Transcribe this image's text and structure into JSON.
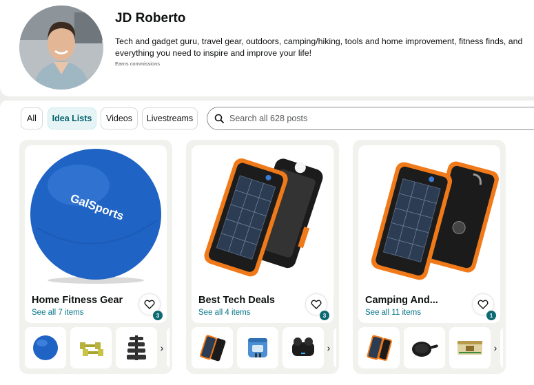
{
  "profile": {
    "name": "JD Roberto",
    "bio": "Tech and gadget guru, travel gear, outdoors, camping/hiking, tools and home improvement, fitness finds, and everything you need to inspire and improve your life!",
    "earns": "Earns commissions"
  },
  "filters": {
    "tabs": [
      {
        "label": "All",
        "active": false
      },
      {
        "label": "Idea Lists",
        "active": true
      },
      {
        "label": "Videos",
        "active": false
      },
      {
        "label": "Livestreams",
        "active": false
      }
    ],
    "search_placeholder": "Search all 628 posts"
  },
  "cards": [
    {
      "title": "Home Fitness Gear",
      "link": "See all 7 items",
      "badge": "3",
      "image": "exercise-ball",
      "ball_brand": "GalSports",
      "thumbs": [
        "exercise-ball-thumb",
        "dumbbells-thumb",
        "dumbbell-rack-thumb"
      ]
    },
    {
      "title": "Best Tech Deals",
      "link": "See all 4 items",
      "badge": "3",
      "image": "solar-power-bank",
      "thumbs": [
        "power-bank-thumb",
        "travel-adapter-thumb",
        "earbuds-thumb"
      ]
    },
    {
      "title": "Camping And...",
      "link": "See all 11 items",
      "badge": "1",
      "image": "solar-power-bank",
      "thumbs": [
        "power-bank-thumb",
        "skillet-thumb",
        "ration-box-thumb"
      ]
    }
  ],
  "colors": {
    "accent": "#007185",
    "active_pill_bg": "#e6f4f6",
    "badge": "#0d6a72",
    "ball": "#1f63c4"
  }
}
